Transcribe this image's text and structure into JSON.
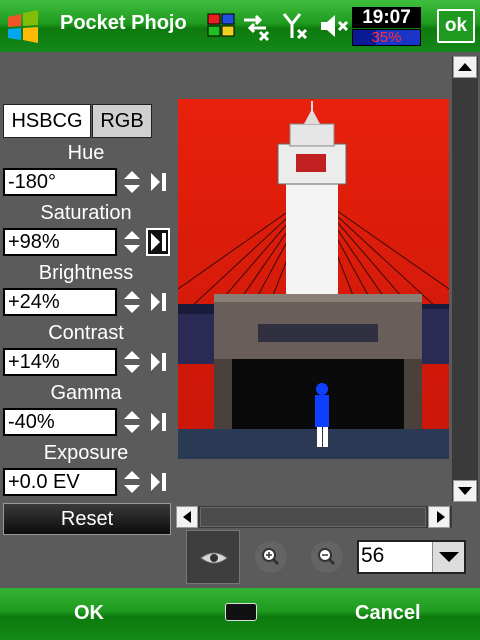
{
  "app": {
    "title": "Pocket Phojo"
  },
  "status": {
    "time": "19:07",
    "battery": "35%",
    "battery_level": 0.35,
    "icons": [
      "windows-start-icon",
      "connectivity-icon",
      "sync-icon",
      "signal-off-icon",
      "volume-off-icon"
    ]
  },
  "titlebar": {
    "ok_label": "ok"
  },
  "tabs": [
    {
      "label": "HSBCG",
      "active": true
    },
    {
      "label": "RGB",
      "active": false
    }
  ],
  "parameters": [
    {
      "label": "Hue",
      "value": "-180°"
    },
    {
      "label": "Saturation",
      "value": "+98%"
    },
    {
      "label": "Brightness",
      "value": "+24%"
    },
    {
      "label": "Contrast",
      "value": "+14%"
    },
    {
      "label": "Gamma",
      "value": "-40%"
    },
    {
      "label": "Exposure",
      "value": "+0.0 EV"
    }
  ],
  "reset_label": "Reset",
  "zoom": {
    "value": "56"
  },
  "softkeys": {
    "left": "OK",
    "right": "Cancel"
  },
  "colors": {
    "titlebar": "#1f9a1f",
    "background": "#5b5b5b",
    "sky": "#e01c0c",
    "battery": "#1a34c8"
  }
}
